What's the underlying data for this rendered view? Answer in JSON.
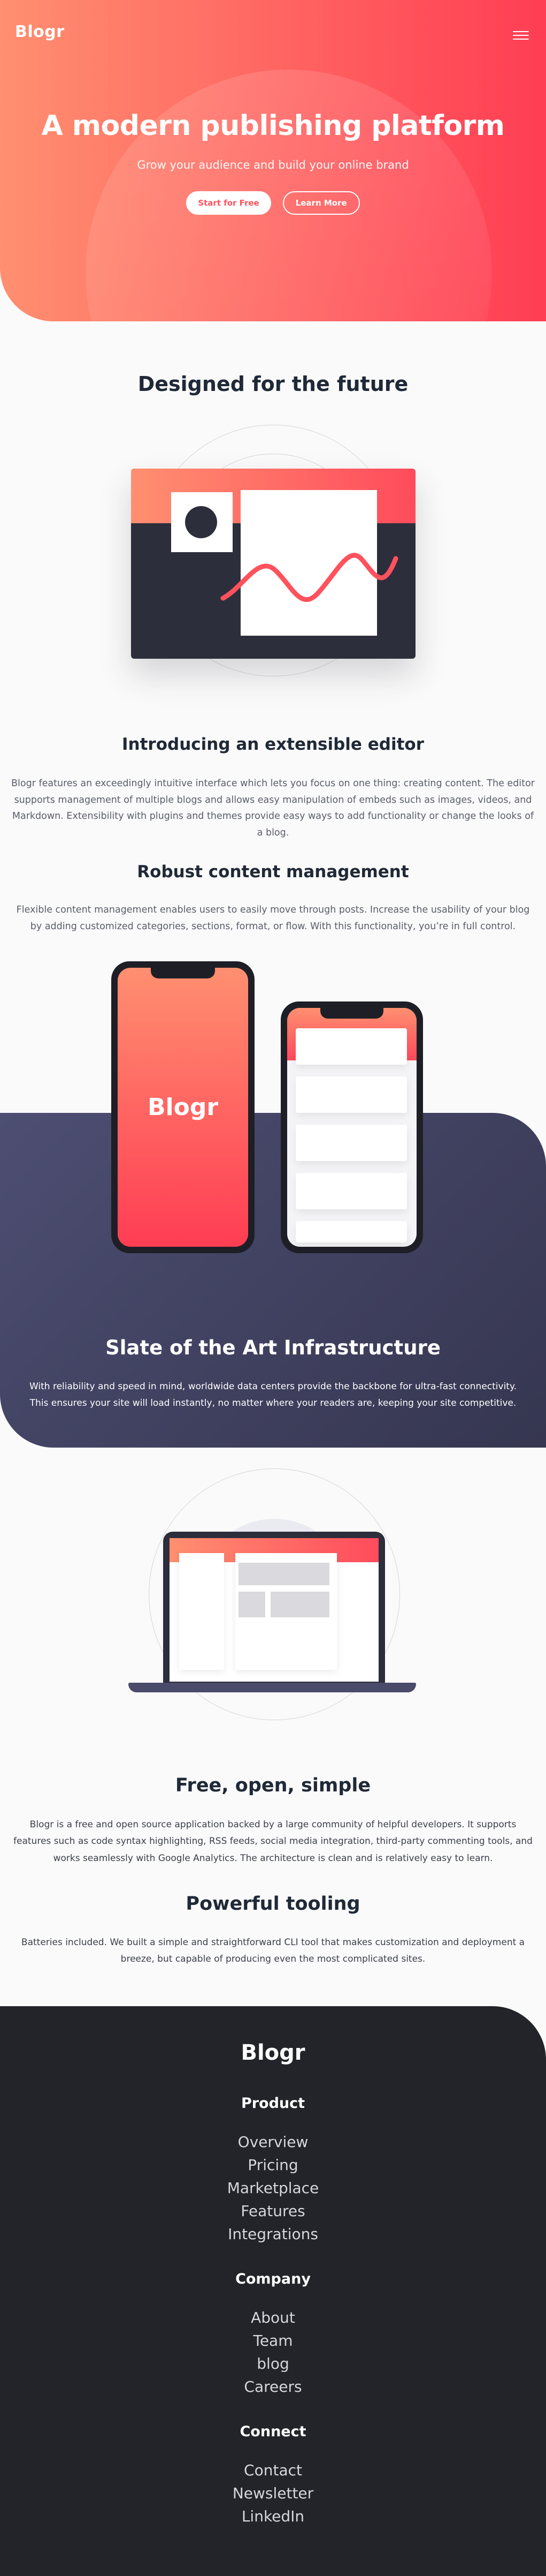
{
  "header": {
    "logo": "Blogr",
    "menu_icon": "hamburger-menu-icon"
  },
  "hero": {
    "title": "A modern publishing platform",
    "subtitle": "Grow your audience and build your online brand",
    "primary_button": "Start for Free",
    "secondary_button": "Learn More"
  },
  "future": {
    "heading": "Designed for the future",
    "editor_title": "Introducing an extensible editor",
    "editor_text": "Blogr features an exceedingly intuitive interface which lets you focus on one thing: creating content. The editor supports management of multiple blogs and allows easy manipulation of embeds such as images, videos, and Markdown. Extensibility with plugins and themes provide easy ways to add functionality or change the looks of a blog.",
    "content_title": "Robust content management",
    "content_text": "Flexible content management enables users to easily move through posts. Increase the usability of your blog by adding customized categories, sections, format, or flow. With this functionality, you’re in full control."
  },
  "infrastructure": {
    "phone_logo": "Blogr",
    "heading": "Slate of the Art Infrastructure",
    "text": "With reliability and speed in mind, worldwide data centers provide the backbone for ultra-fast connectivity. This ensures your site will load instantly, no matter where your readers are, keeping your site competitive."
  },
  "features": {
    "free_title": "Free, open, simple",
    "free_text": "Blogr is a free and open source application backed by a large community of helpful developers. It supports features such as code syntax highlighting, RSS feeds, social media integration, third-party commenting tools, and works seamlessly with Google Analytics. The architecture is clean and is relatively easy to learn.",
    "tooling_title": "Powerful tooling",
    "tooling_text": "Batteries included. We built a simple and straightforward CLI tool that makes customization and deployment a breeze, but capable of producing even the most complicated sites."
  },
  "footer": {
    "logo": "Blogr",
    "product": {
      "heading": "Product",
      "links": [
        "Overview",
        "Pricing",
        "Marketplace",
        "Features",
        "Integrations"
      ]
    },
    "company": {
      "heading": "Company",
      "links": [
        "About",
        "Team",
        "blog",
        "Careers"
      ]
    },
    "connect": {
      "heading": "Connect",
      "links": [
        "Contact",
        "Newsletter",
        "LinkedIn"
      ]
    }
  },
  "colors": {
    "accent_start": "#ff8f70",
    "accent_end": "#ff3d54",
    "dark_blue": "#4d4e72",
    "footer_bg": "#232429"
  }
}
